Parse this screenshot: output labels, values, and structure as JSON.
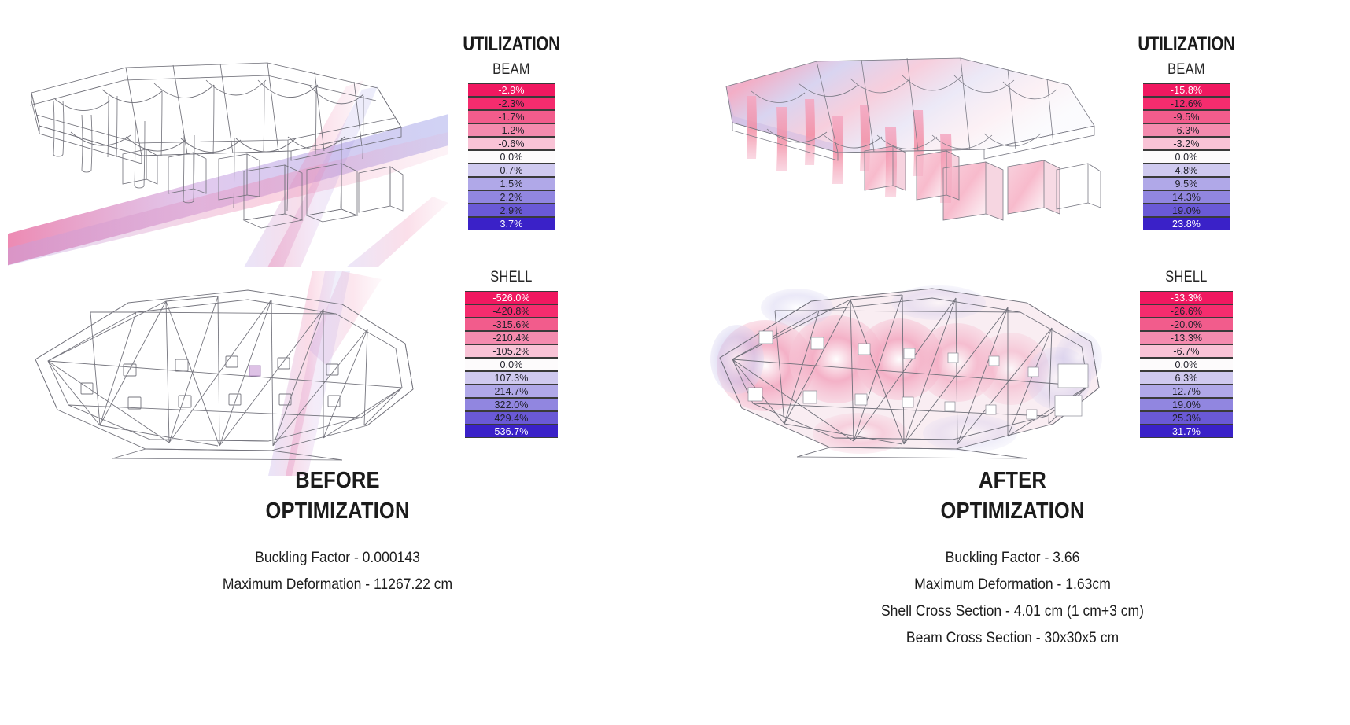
{
  "legends": {
    "before": {
      "title": "UTILIZATION",
      "beam": {
        "label": "BEAM",
        "stops": [
          "-2.9%",
          "-2.3%",
          "-1.7%",
          "-1.2%",
          "-0.6%",
          "0.0%",
          "0.7%",
          "1.5%",
          "2.2%",
          "2.9%",
          "3.7%"
        ]
      },
      "shell": {
        "label": "SHELL",
        "stops": [
          "-526.0%",
          "-420.8%",
          "-315.6%",
          "-210.4%",
          "-105.2%",
          "0.0%",
          "107.3%",
          "214.7%",
          "322.0%",
          "429.4%",
          "536.7%"
        ]
      }
    },
    "after": {
      "title": "UTILIZATION",
      "beam": {
        "label": "BEAM",
        "stops": [
          "-15.8%",
          "-12.6%",
          "-9.5%",
          "-6.3%",
          "-3.2%",
          "0.0%",
          "4.8%",
          "9.5%",
          "14.3%",
          "19.0%",
          "23.8%"
        ]
      },
      "shell": {
        "label": "SHELL",
        "stops": [
          "-33.3%",
          "-26.6%",
          "-20.0%",
          "-13.3%",
          "-6.7%",
          "0.0%",
          "6.3%",
          "12.7%",
          "19.0%",
          "25.3%",
          "31.7%"
        ]
      }
    }
  },
  "ramp_colors": [
    "#f01860",
    "#f52c6e",
    "#f25c8c",
    "#f48bae",
    "#f9c3d6",
    "#fdfbfc",
    "#cfc9ef",
    "#b0a8e8",
    "#9186e0",
    "#6a59d6",
    "#3a21c8"
  ],
  "captions": {
    "before": {
      "head_line1": "BEFORE",
      "head_line2": "OPTIMIZATION",
      "lines": [
        "Buckling Factor - 0.000143",
        "Maximum Deformation  - 11267.22 cm"
      ]
    },
    "after": {
      "head_line1": "AFTER",
      "head_line2": "OPTIMIZATION",
      "lines": [
        "Buckling Factor - 3.66",
        "Maximum Deformation  - 1.63cm",
        "Shell Cross Section - 4.01 cm (1 cm+3 cm)",
        "Beam Cross Section - 30x30x5 cm"
      ]
    }
  },
  "models": {
    "before_perspective": "wireframe-canopy-buckled",
    "before_plan": "wireframe-plan-mesh",
    "after_perspective": "stress-colored-canopy",
    "after_plan": "stress-colored-plan-mesh"
  }
}
